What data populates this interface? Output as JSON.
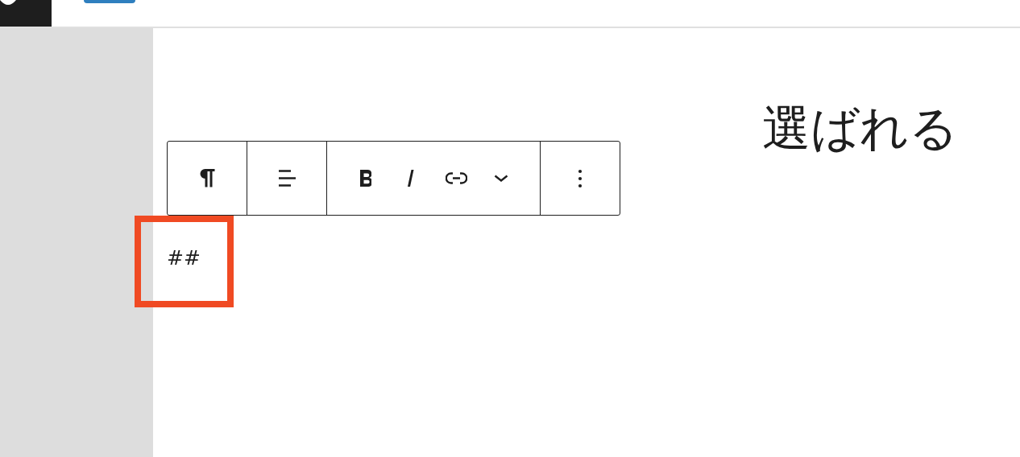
{
  "heading": {
    "text": "選ばれる"
  },
  "block_toolbar": {
    "groups": [
      {
        "buttons": [
          {
            "kind": "paragraph"
          }
        ]
      },
      {
        "buttons": [
          {
            "kind": "align"
          }
        ]
      },
      {
        "buttons": [
          {
            "kind": "bold"
          },
          {
            "kind": "italic"
          },
          {
            "kind": "link"
          },
          {
            "kind": "more-rich"
          }
        ]
      },
      {
        "buttons": [
          {
            "kind": "options"
          }
        ]
      }
    ]
  },
  "block": {
    "text": "##",
    "highlighted": true
  }
}
